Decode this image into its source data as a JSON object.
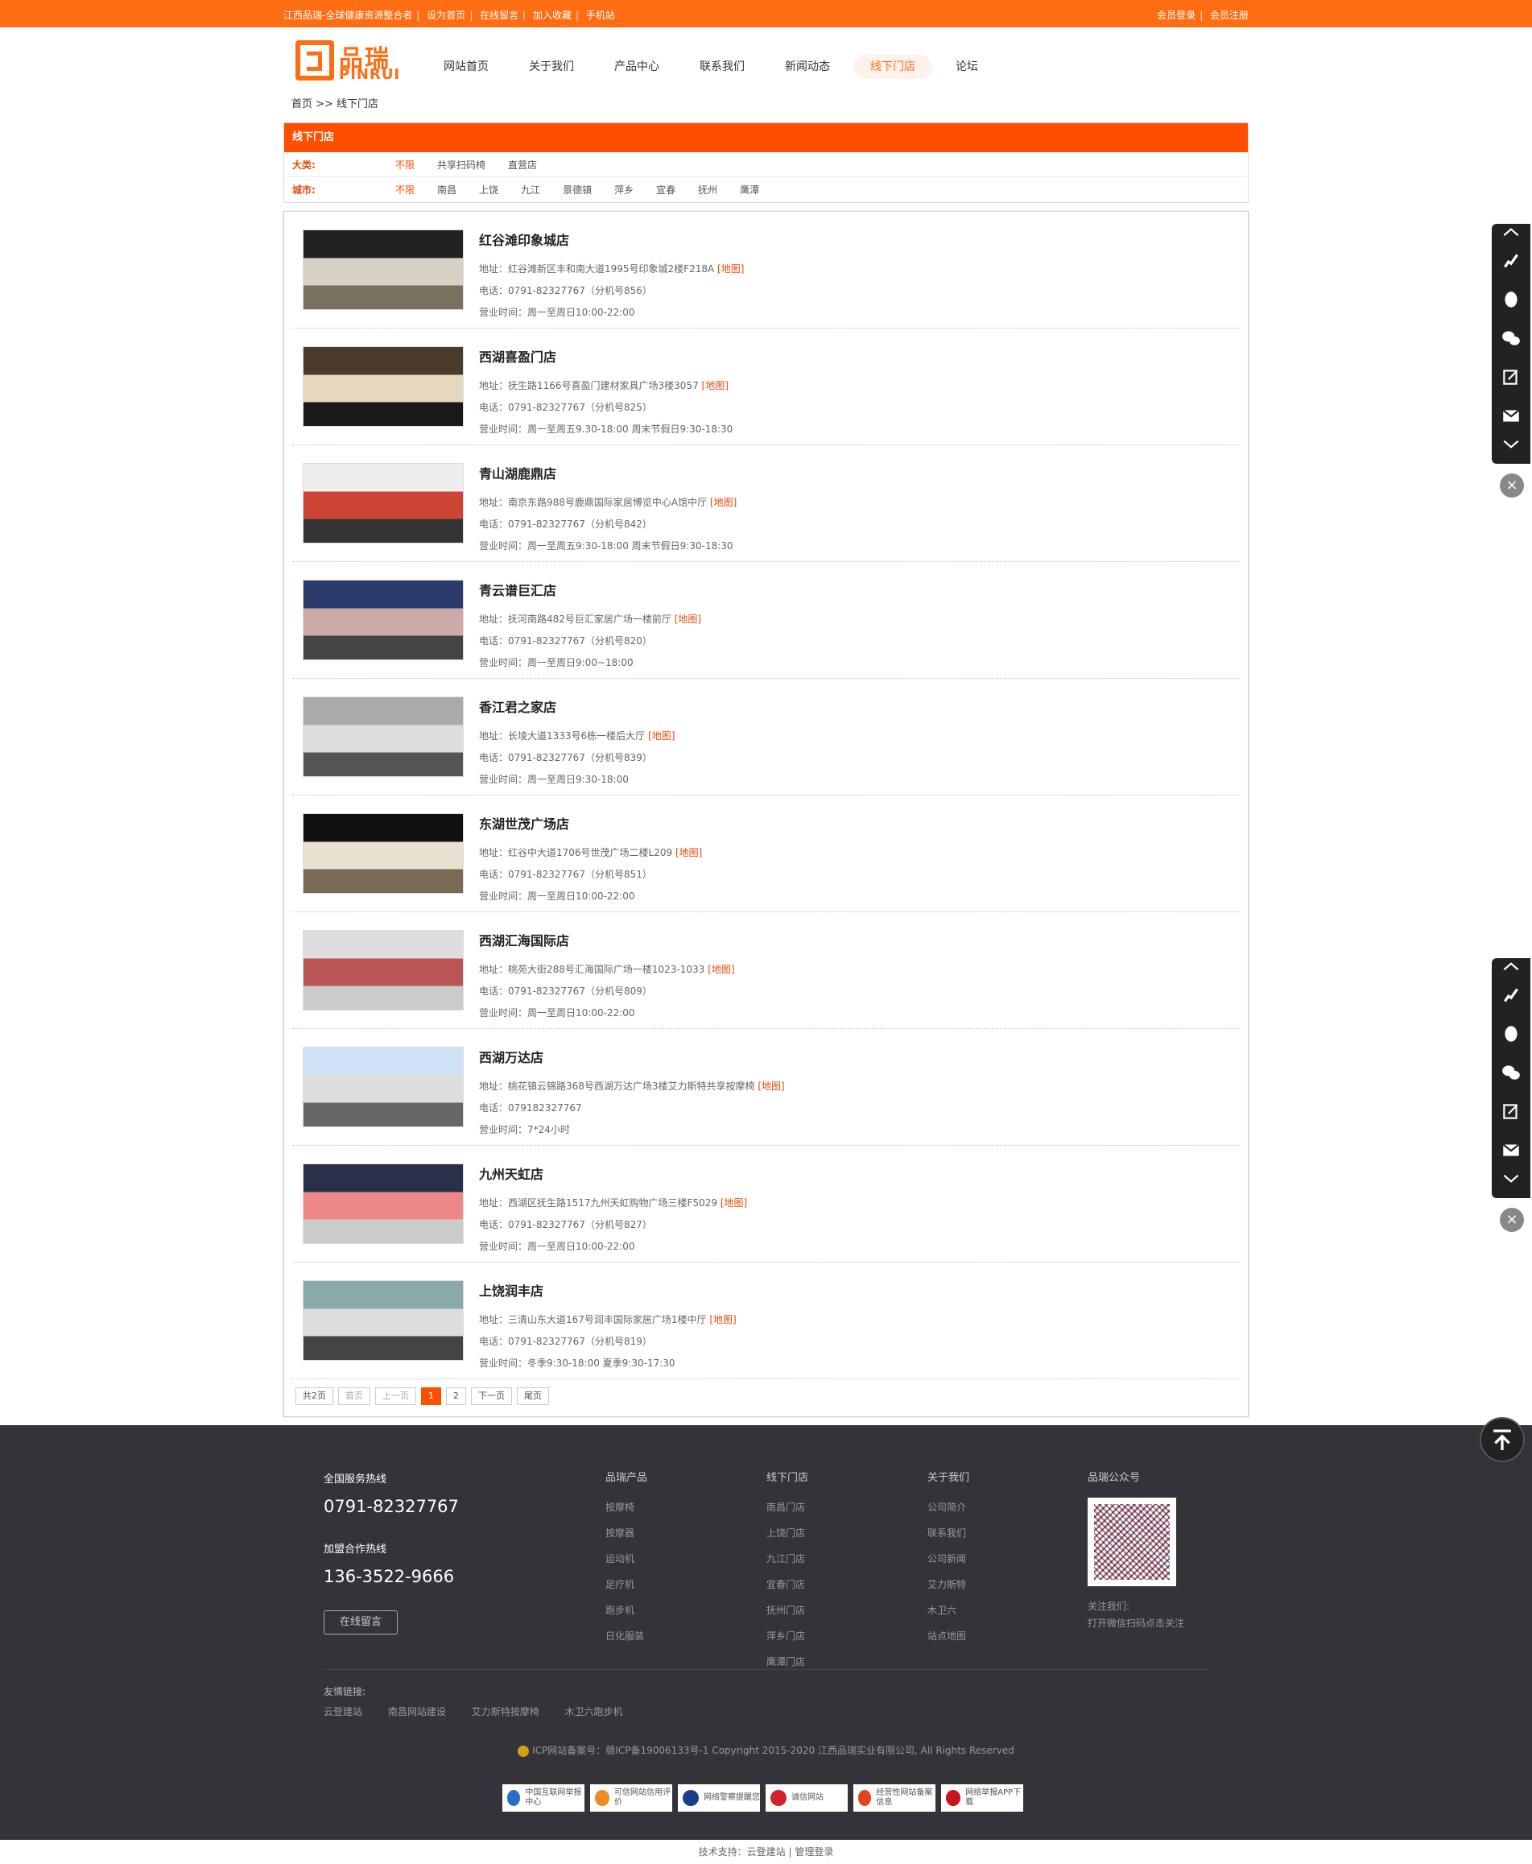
{
  "topbar": {
    "left": [
      "江西品瑞-全球健康资源整合者",
      "设为首页",
      "在线留言",
      "加入收藏",
      "手机站"
    ],
    "right": [
      "会员登录",
      "会员注册"
    ]
  },
  "logo": {
    "cn": "品瑞",
    "en": "PINRUI"
  },
  "nav": [
    "网站首页",
    "关于我们",
    "产品中心",
    "联系我们",
    "新闻动态",
    "线下门店",
    "论坛"
  ],
  "breadcrumb": "首页 >> 线下门店",
  "filter": {
    "title": "线下门店",
    "category_label": "大类:",
    "categories": [
      "不限",
      "共享扫码椅",
      "直营店"
    ],
    "city_label": "城市:",
    "cities": [
      "不限",
      "南昌",
      "上饶",
      "九江",
      "景德镇",
      "萍乡",
      "宜春",
      "抚州",
      "鹰潭"
    ]
  },
  "map_label": "[地图]",
  "stores": [
    {
      "name": "红谷滩印象城店",
      "addr": "地址：红谷滩新区丰和南大道1995号印象城2楼F218A",
      "tel": "电话：0791-82327767（分机号856）",
      "hours": "营业时间：周一至周日10:00-22:00"
    },
    {
      "name": "西湖喜盈门店",
      "addr": "地址：抚生路1166号喜盈门建材家具广场3楼3057",
      "tel": "电话：0791-82327767（分机号825）",
      "hours": "营业时间：周一至周五9.30-18:00 周末节假日9:30-18:30"
    },
    {
      "name": "青山湖鹿鼎店",
      "addr": "地址：南京东路988号鹿鼎国际家居博览中心A馆中厅",
      "tel": "电话：0791-82327767（分机号842）",
      "hours": "营业时间：周一至周五9:30-18:00 周末节假日9:30-18:30"
    },
    {
      "name": "青云谱巨汇店",
      "addr": "地址：抚河南路482号巨汇家居广场一楼前厅",
      "tel": "电话：0791-82327767（分机号820）",
      "hours": "营业时间：周一至周日9:00~18:00"
    },
    {
      "name": "香江君之家店",
      "addr": "地址：长堎大道1333号6栋一楼后大厅",
      "tel": "电话：0791-82327767（分机号839）",
      "hours": "营业时间：周一至周日9:30-18:00"
    },
    {
      "name": "东湖世茂广场店",
      "addr": "地址：红谷中大道1706号世茂广场二楼L209",
      "tel": "电话：0791-82327767（分机号851）",
      "hours": "营业时间：周一至周日10:00-22:00"
    },
    {
      "name": "西湖汇海国际店",
      "addr": "地址：桃苑大街288号汇海国际广场一楼1023-1033",
      "tel": "电话：0791-82327767（分机号809）",
      "hours": "营业时间：周一至周日10:00-22:00"
    },
    {
      "name": "西湖万达店",
      "addr": "地址：桃花镇云锦路368号西湖万达广场3楼艾力斯特共享按摩椅",
      "tel": "电话：079182327767",
      "hours": "营业时间：7*24小时"
    },
    {
      "name": "九州天虹店",
      "addr": "地址：西湖区抚生路1517九州天虹购物广场三楼F5029",
      "tel": "电话：0791-82327767（分机号827）",
      "hours": "营业时间：周一至周日10:00-22:00"
    },
    {
      "name": "上饶润丰店",
      "addr": "地址：三清山东大道167号润丰国际家居广场1楼中厅",
      "tel": "电话：0791-82327767（分机号819）",
      "hours": "营业时间：冬季9:30-18:00 夏季9:30-17:30"
    }
  ],
  "pager": [
    "共2页",
    "首页",
    "上一页",
    "1",
    "2",
    "下一页",
    "尾页"
  ],
  "footer": {
    "hotline_title": "全国服务热线",
    "hotline": "0791-82327767",
    "join_title": "加盟合作热线",
    "join": "136-3522-9666",
    "msg_btn": "在线留言",
    "col1": {
      "title": "品瑞产品",
      "items": [
        "按摩椅",
        "按摩器",
        "运动机",
        "足疗机",
        "跑步机",
        "日化服装"
      ]
    },
    "col2": {
      "title": "线下门店",
      "items": [
        "南昌门店",
        "上饶门店",
        "九江门店",
        "宜春门店",
        "抚州门店",
        "萍乡门店",
        "鹰潭门店"
      ]
    },
    "col3": {
      "title": "关于我们",
      "items": [
        "公司简介",
        "联系我们",
        "公司新闻",
        "艾力斯特",
        "木卫六",
        "站点地图"
      ]
    },
    "wechat_title": "品瑞公众号",
    "wechat_note1": "关注我们:",
    "wechat_note2": "打开微信扫码点击关注",
    "links_title": "友情链接:",
    "links": [
      "云登建站",
      "南昌网站建设",
      "艾力斯特按摩椅",
      "木卫六跑步机"
    ],
    "copyright": "ICP网站备案号：赣ICP备19006133号-1  Copyright 2015-2020 江西品瑞实业有限公司, All Rights Reserved",
    "badges": [
      "中国互联网举报中心",
      "可信网站信用评价",
      "网络警察提醒您",
      "诚信网站",
      "经营性网站备案信息",
      "网络举报APP下载"
    ],
    "tech": "技术支持：云登建站 | 管理登录"
  },
  "colors": {
    "accent": "#ff6d12",
    "filter_head": "#ff4e00",
    "footer": "#34333a"
  }
}
